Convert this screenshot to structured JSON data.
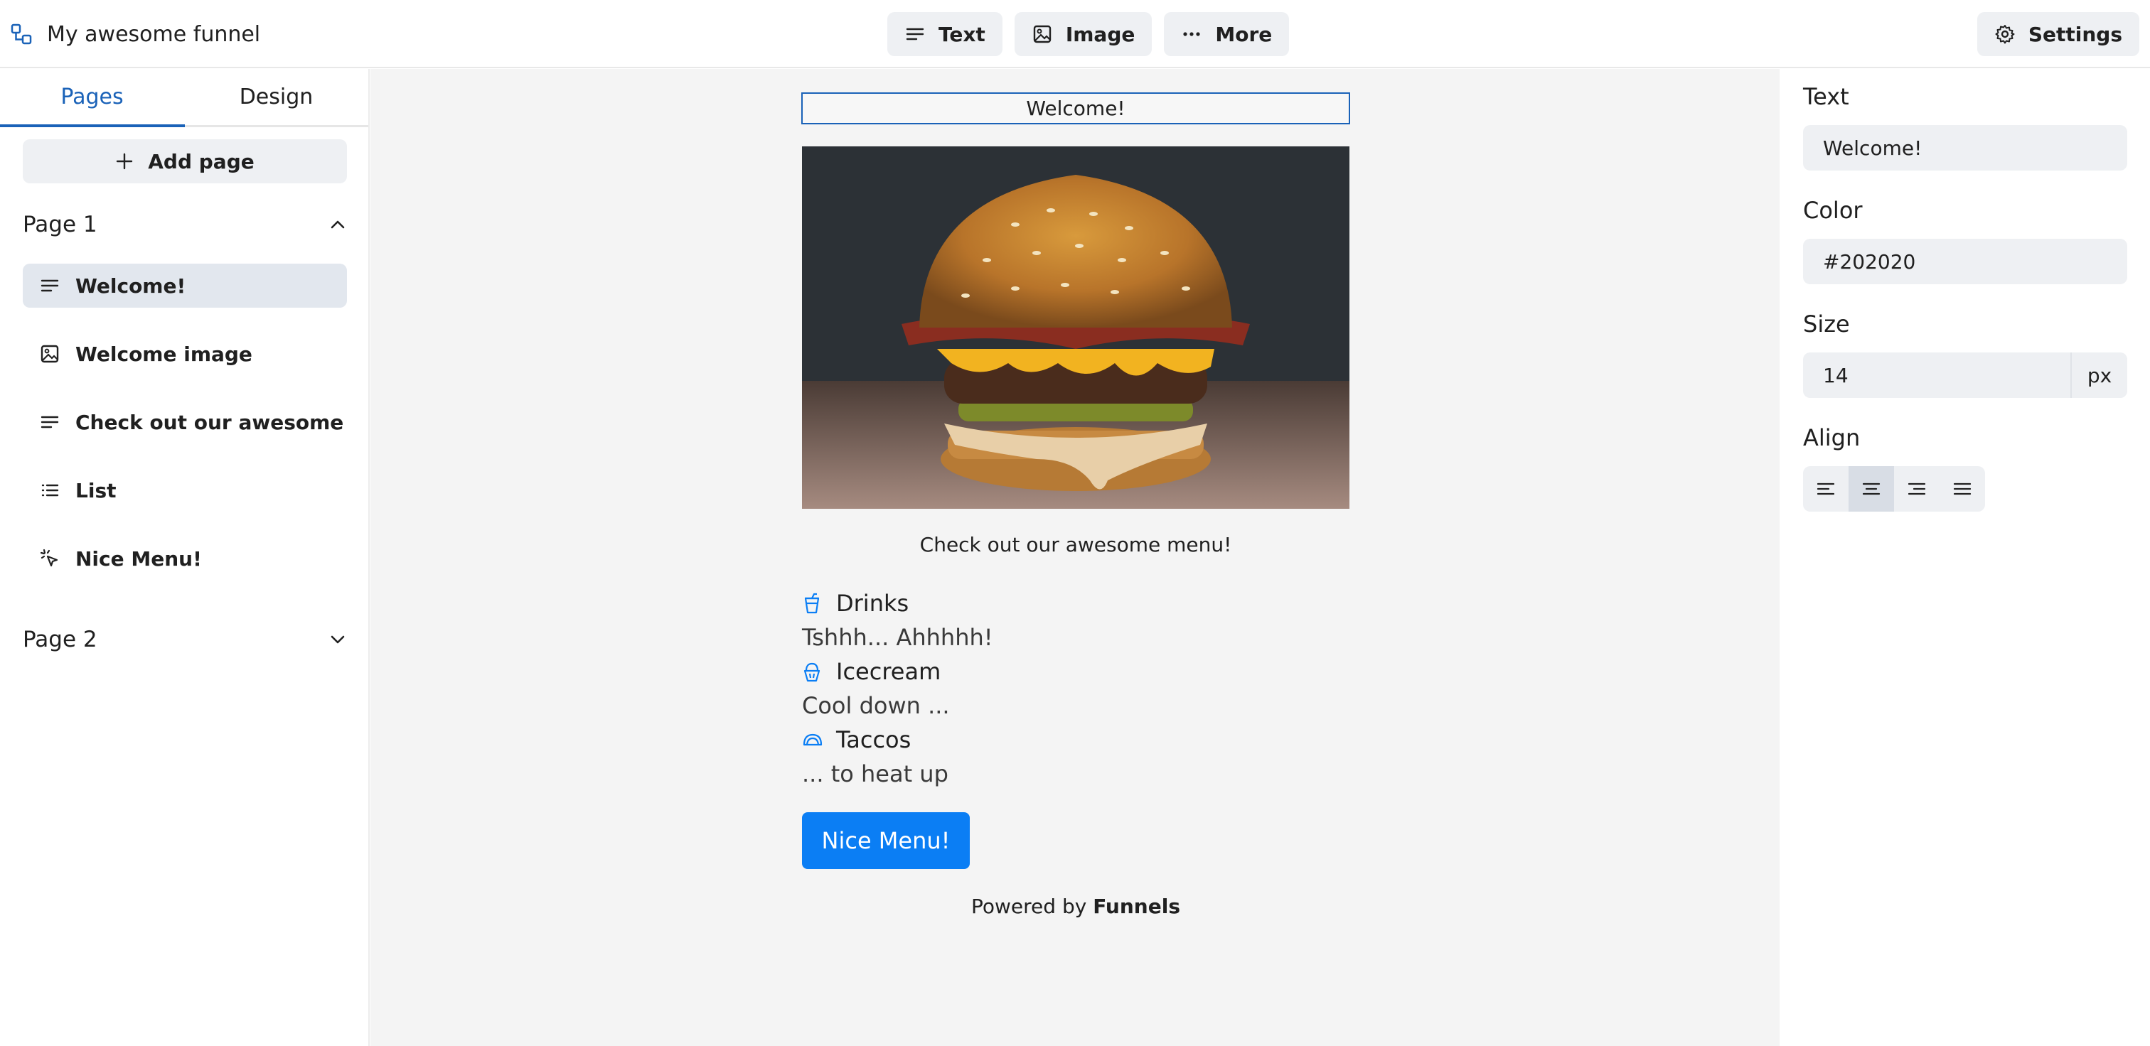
{
  "app": {
    "title": "My awesome funnel"
  },
  "toolbar": {
    "text_label": "Text",
    "image_label": "Image",
    "more_label": "More",
    "settings_label": "Settings"
  },
  "sidebar": {
    "tabs": [
      {
        "label": "Pages",
        "active": true
      },
      {
        "label": "Design",
        "active": false
      }
    ],
    "add_page_label": "Add page",
    "pages": [
      {
        "label": "Page 1",
        "expanded": true,
        "items": [
          {
            "label": "Welcome!",
            "icon": "text-icon",
            "selected": true
          },
          {
            "label": "Welcome image",
            "icon": "image-icon",
            "selected": false
          },
          {
            "label": "Check out our awesome menu!",
            "icon": "text-icon",
            "selected": false
          },
          {
            "label": "List",
            "icon": "list-icon",
            "selected": false
          },
          {
            "label": "Nice Menu!",
            "icon": "click-icon",
            "selected": false
          }
        ]
      },
      {
        "label": "Page 2",
        "expanded": false,
        "items": []
      }
    ]
  },
  "canvas": {
    "welcome_text": "Welcome!",
    "menu_caption": "Check out our awesome menu!",
    "menu": [
      {
        "icon": "drink-cup-icon",
        "title": "Drinks",
        "description": "Tshhh... Ahhhhh!"
      },
      {
        "icon": "icecream-icon",
        "title": "Icecream",
        "description": "Cool down ..."
      },
      {
        "icon": "taco-icon",
        "title": "Taccos",
        "description": "... to heat up"
      }
    ],
    "button_label": "Nice Menu!",
    "powered_prefix": "Powered by",
    "powered_brand": "Funnels"
  },
  "properties": {
    "text_label": "Text",
    "text_value": "Welcome!",
    "color_label": "Color",
    "color_value": "#202020",
    "size_label": "Size",
    "size_value": "14",
    "size_unit": "px",
    "align_label": "Align",
    "align_options": [
      "left",
      "center",
      "right",
      "justify"
    ],
    "align_selected": "center"
  },
  "colors": {
    "accent": "#1a62b8",
    "button": "#0b7ef4",
    "text": "#202020",
    "canvas_bg": "#f4f4f4"
  }
}
